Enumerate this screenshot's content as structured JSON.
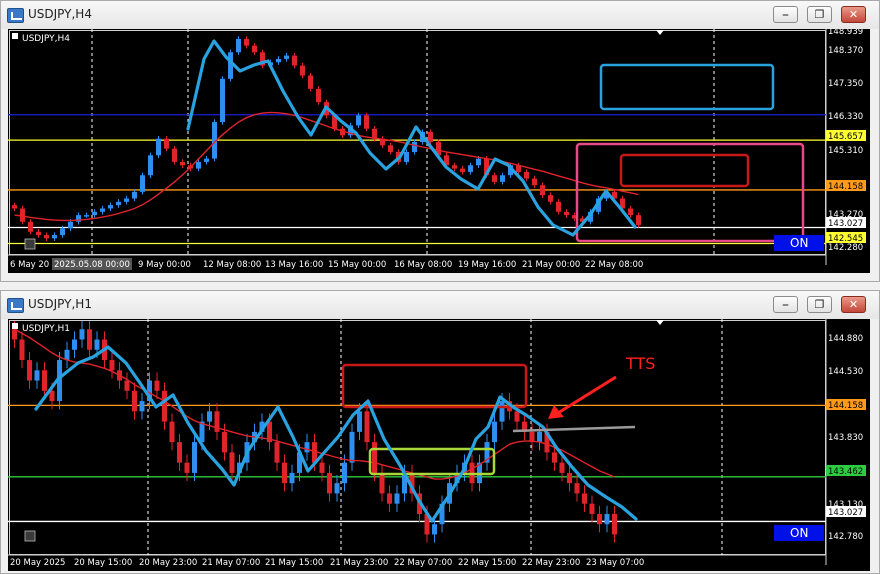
{
  "colors": {
    "candle_up": "#2f8ff0",
    "candle_down": "#e0242b",
    "ma_line": "#e0242b",
    "drawn_path": "#29a3e0",
    "grid": "#ffffff",
    "on_button": "#0010e8"
  },
  "windows": [
    {
      "title": "USDJPY,H4",
      "chart_label": "USDJPY,H4",
      "buttons": [
        "minimize-icon",
        "restore-icon",
        "close-icon"
      ],
      "price_labels": [
        "148.939",
        "148.370",
        "147.350",
        "146.330",
        "145.657",
        "145.310",
        "144.158",
        "143.270",
        "143.027",
        "142.545",
        "142.280"
      ],
      "time_labels": [
        "6 May 20",
        "2025.05.08 00:00",
        "9 May 00:00",
        "12 May 08:00",
        "13 May 16:00",
        "15 May 00:00",
        "16 May 08:00",
        "19 May 16:00",
        "21 May 00:00",
        "22 May 08:00"
      ],
      "on_label": "ON"
    },
    {
      "title": "USDJPY,H1",
      "chart_label": "USDJPY,H1",
      "buttons": [
        "minimize-icon",
        "restore-icon",
        "close-icon"
      ],
      "price_labels": [
        "144.880",
        "144.530",
        "144.158",
        "143.830",
        "143.462",
        "143.130",
        "143.027",
        "142.780"
      ],
      "time_labels": [
        "20 May 2025",
        "20 May 15:00",
        "20 May 23:00",
        "21 May 07:00",
        "21 May 15:00",
        "21 May 23:00",
        "22 May 07:00",
        "22 May 15:00",
        "22 May 23:00",
        "23 May 07:00"
      ],
      "annotation": "TTS",
      "on_label": "ON"
    }
  ],
  "chart_data": [
    {
      "type": "candlestick",
      "title": "USDJPY,H4",
      "ylim": [
        142.2,
        149.0
      ],
      "x": [
        "6 May 20",
        "2025.05.08 00:00",
        "9 May 00:00",
        "12 May 08:00",
        "13 May 16:00",
        "15 May 00:00",
        "16 May 08:00",
        "19 May 16:00",
        "21 May 00:00",
        "22 May 08:00"
      ],
      "levels": [
        {
          "value": 146.42,
          "color": "#1a20d8"
        },
        {
          "value": 145.657,
          "color": "#ffff33"
        },
        {
          "value": 144.158,
          "color": "#ff9a1a"
        },
        {
          "value": 143.027,
          "color": "#ffffff"
        },
        {
          "value": 142.545,
          "color": "#ffff33"
        }
      ],
      "series": [
        {
          "values": [
            143.6,
            143.2,
            142.9,
            142.8,
            142.7,
            142.8,
            143.0,
            143.2,
            143.4,
            143.4,
            143.5,
            143.6,
            143.7,
            143.8,
            143.9,
            144.1,
            144.6,
            145.2,
            145.7,
            145.4,
            145.0,
            144.9,
            144.8,
            145.0,
            145.1,
            146.2,
            147.5,
            148.3,
            148.7,
            148.5,
            148.3,
            147.9,
            148.0,
            148.1,
            148.2,
            147.9,
            147.6,
            147.2,
            146.8,
            146.4,
            146.0,
            145.8,
            146.1,
            146.4,
            146.0,
            145.7,
            145.5,
            145.3,
            145.0,
            145.3,
            145.6,
            145.9,
            145.6,
            145.2,
            144.9,
            144.8,
            144.7,
            144.9,
            145.1,
            144.6,
            144.4,
            144.6,
            144.9,
            144.7,
            144.5,
            144.3,
            144.0,
            143.8,
            143.5,
            143.4,
            143.3,
            143.2,
            143.5,
            143.9,
            144.1,
            143.9,
            143.6,
            143.4,
            143.1
          ]
        },
        {
          "values": [
            143.4,
            143.37,
            143.33,
            143.3,
            143.27,
            143.25,
            143.24,
            143.24,
            143.25,
            143.27,
            143.3,
            143.34,
            143.39,
            143.45,
            143.52,
            143.6,
            143.71,
            143.86,
            144.03,
            144.21,
            144.4,
            144.61,
            144.84,
            145.09,
            145.34,
            145.59,
            145.82,
            146.02,
            146.2,
            146.33,
            146.42,
            146.47,
            146.49,
            146.48,
            146.45,
            146.4,
            146.33,
            146.25,
            146.17,
            146.08,
            146.0,
            145.93,
            145.86,
            145.8,
            145.75,
            145.71,
            145.68,
            145.65,
            145.61,
            145.56,
            145.5,
            145.45,
            145.4,
            145.35,
            145.3,
            145.26,
            145.22,
            145.18,
            145.14,
            145.1,
            145.06,
            145.01,
            144.96,
            144.9,
            144.84,
            144.78,
            144.72,
            144.65,
            144.58,
            144.51,
            144.44,
            144.37,
            144.31,
            144.26,
            144.22,
            144.17,
            144.12,
            144.07,
            144.02
          ]
        }
      ],
      "drawn_path": [
        [
          180,
          100
        ],
        [
          196,
          30
        ],
        [
          206,
          12
        ],
        [
          218,
          28
        ],
        [
          232,
          42
        ],
        [
          246,
          36
        ],
        [
          260,
          32
        ],
        [
          275,
          62
        ],
        [
          290,
          88
        ],
        [
          303,
          106
        ],
        [
          318,
          78
        ],
        [
          333,
          92
        ],
        [
          348,
          104
        ],
        [
          362,
          124
        ],
        [
          378,
          140
        ],
        [
          392,
          128
        ],
        [
          408,
          98
        ],
        [
          423,
          118
        ],
        [
          438,
          138
        ],
        [
          453,
          150
        ],
        [
          470,
          160
        ],
        [
          487,
          130
        ],
        [
          500,
          136
        ],
        [
          515,
          152
        ],
        [
          530,
          178
        ],
        [
          545,
          196
        ],
        [
          565,
          206
        ],
        [
          582,
          186
        ],
        [
          598,
          162
        ],
        [
          613,
          180
        ],
        [
          627,
          198
        ]
      ],
      "boxes": [
        {
          "x0": 593,
          "y0": 36,
          "x1": 765,
          "y1": 80,
          "color": "#29a3e0"
        },
        {
          "x0": 569,
          "y0": 115,
          "x1": 795,
          "y1": 212,
          "color": "#e84a87"
        },
        {
          "x0": 613,
          "y0": 126,
          "x1": 740,
          "y1": 157,
          "color": "#c81818"
        }
      ]
    },
    {
      "type": "candlestick",
      "title": "USDJPY,H1",
      "ylim": [
        142.7,
        145.0
      ],
      "x": [
        "20 May 2025",
        "20 May 15:00",
        "20 May 23:00",
        "21 May 07:00",
        "21 May 15:00",
        "21 May 23:00",
        "22 May 07:00",
        "22 May 15:00",
        "22 May 23:00",
        "23 May 07:00"
      ],
      "levels": [
        {
          "value": 144.158,
          "color": "#ff9a1a"
        },
        {
          "value": 143.462,
          "color": "#2ecc40"
        },
        {
          "value": 143.027,
          "color": "#ffffff"
        }
      ],
      "series": [
        {
          "values": [
            144.8,
            144.6,
            144.4,
            144.5,
            144.3,
            144.2,
            144.6,
            144.7,
            144.8,
            144.9,
            144.7,
            144.8,
            144.6,
            144.5,
            144.4,
            144.3,
            144.1,
            144.2,
            144.4,
            144.3,
            144.0,
            143.8,
            143.6,
            143.5,
            143.8,
            144.0,
            144.1,
            143.9,
            143.7,
            143.5,
            143.6,
            143.8,
            143.9,
            144.0,
            143.8,
            143.6,
            143.4,
            143.5,
            143.7,
            143.8,
            143.6,
            143.5,
            143.3,
            143.4,
            143.6,
            143.9,
            144.1,
            143.8,
            143.5,
            143.3,
            143.2,
            143.3,
            143.5,
            143.3,
            143.1,
            142.9,
            143.0,
            143.2,
            143.4,
            143.5,
            143.6,
            143.4,
            143.6,
            143.8,
            144.0,
            144.2,
            144.1,
            144.0,
            143.9,
            143.8,
            143.9,
            143.7,
            143.6,
            143.5,
            143.4,
            143.3,
            143.2,
            143.1,
            143.0,
            143.1,
            142.9
          ]
        },
        {
          "values": [
            144.9,
            144.86,
            144.82,
            144.77,
            144.72,
            144.67,
            144.63,
            144.6,
            144.58,
            144.57,
            144.56,
            144.54,
            144.52,
            144.49,
            144.45,
            144.41,
            144.36,
            144.32,
            144.28,
            144.24,
            144.2,
            144.15,
            144.1,
            144.05,
            144.01,
            143.98,
            143.96,
            143.94,
            143.92,
            143.9,
            143.88,
            143.86,
            143.85,
            143.84,
            143.83,
            143.81,
            143.79,
            143.77,
            143.75,
            143.73,
            143.71,
            143.69,
            143.67,
            143.65,
            143.63,
            143.62,
            143.62,
            143.61,
            143.6,
            143.58,
            143.56,
            143.54,
            143.52,
            143.5,
            143.48,
            143.46,
            143.44,
            143.44,
            143.45,
            143.47,
            143.5,
            143.54,
            143.58,
            143.63,
            143.68,
            143.73,
            143.78,
            143.8,
            143.81,
            143.81,
            143.8,
            143.78,
            143.75,
            143.72,
            143.68,
            143.64,
            143.6,
            143.56,
            143.52,
            143.49,
            143.46
          ]
        }
      ],
      "drawn_path": [
        [
          28,
          90
        ],
        [
          50,
          60
        ],
        [
          70,
          44
        ],
        [
          85,
          38
        ],
        [
          100,
          28
        ],
        [
          118,
          44
        ],
        [
          132,
          64
        ],
        [
          148,
          88
        ],
        [
          165,
          76
        ],
        [
          180,
          104
        ],
        [
          198,
          132
        ],
        [
          214,
          150
        ],
        [
          226,
          166
        ],
        [
          240,
          132
        ],
        [
          256,
          108
        ],
        [
          270,
          88
        ],
        [
          285,
          118
        ],
        [
          300,
          152
        ],
        [
          314,
          136
        ],
        [
          330,
          118
        ],
        [
          345,
          96
        ],
        [
          360,
          82
        ],
        [
          376,
          120
        ],
        [
          393,
          148
        ],
        [
          410,
          180
        ],
        [
          424,
          202
        ],
        [
          440,
          178
        ],
        [
          455,
          152
        ],
        [
          468,
          120
        ],
        [
          480,
          108
        ],
        [
          492,
          78
        ],
        [
          505,
          88
        ],
        [
          518,
          96
        ],
        [
          535,
          108
        ],
        [
          548,
          128
        ],
        [
          564,
          148
        ],
        [
          580,
          166
        ],
        [
          598,
          178
        ],
        [
          614,
          188
        ],
        [
          628,
          200
        ]
      ],
      "boxes": [
        {
          "x0": 335,
          "y0": 46,
          "x1": 518,
          "y1": 88,
          "color": "#c81818"
        },
        {
          "x0": 362,
          "y0": 130,
          "x1": 486,
          "y1": 155,
          "color": "#a8d83a"
        }
      ],
      "neckline": [
        [
          505,
          112
        ],
        [
          627,
          108
        ]
      ],
      "arrow": {
        "from": [
          608,
          58
        ],
        "to": [
          540,
          100
        ]
      }
    }
  ]
}
